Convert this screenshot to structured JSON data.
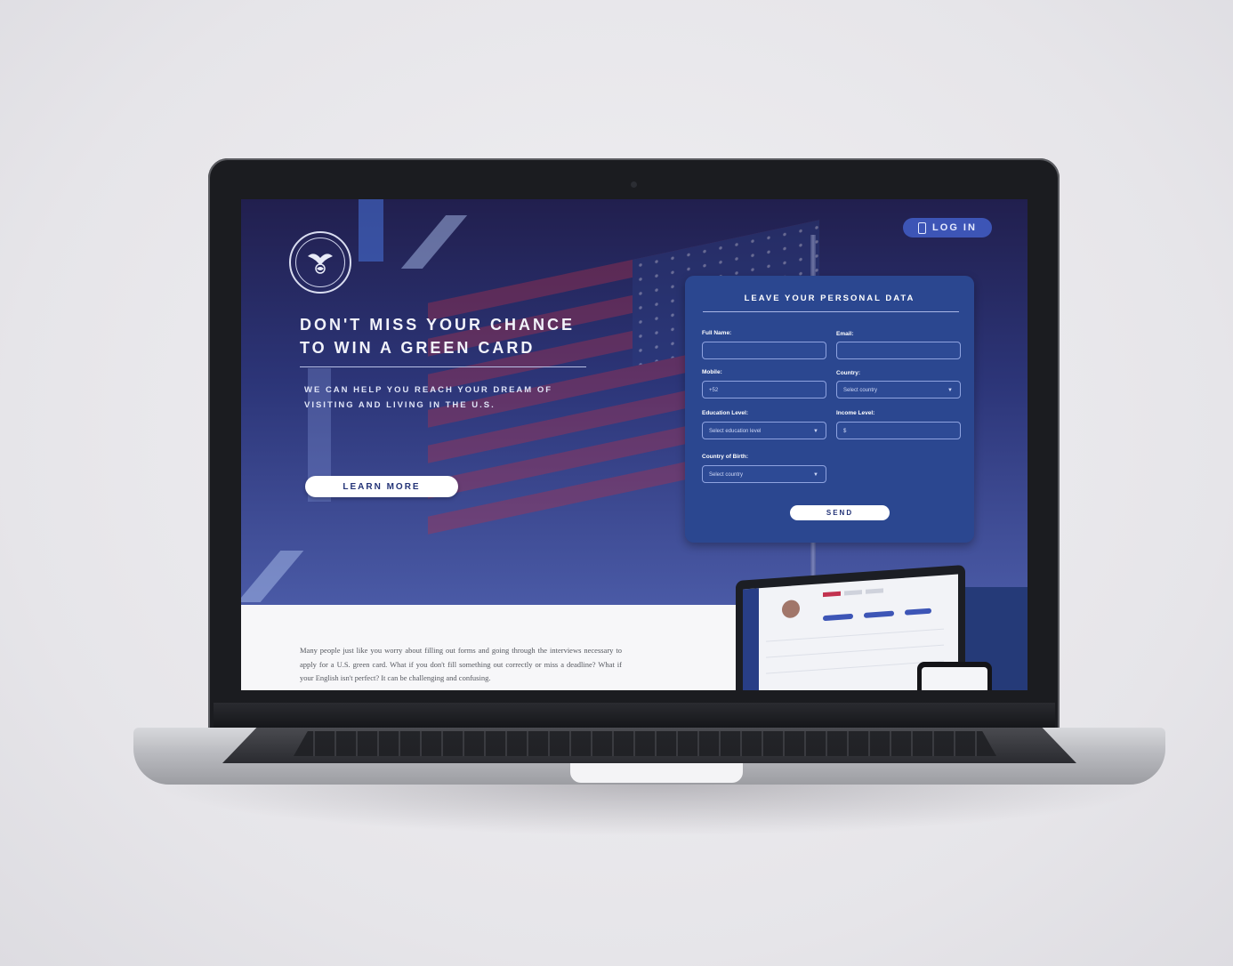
{
  "header": {
    "login_label": "LOG IN"
  },
  "hero": {
    "headline_line1": "DON'T MISS YOUR CHANCE",
    "headline_line2": "TO WIN A GREEN CARD",
    "subtitle_line1": "WE CAN HELP YOU REACH YOUR DREAM OF",
    "subtitle_line2": "VISITING AND LIVING IN THE U.S.",
    "learn_more_label": "LEARN MORE"
  },
  "form": {
    "title": "LEAVE YOUR PERSONAL DATA",
    "full_name_label": "Full Name:",
    "email_label": "Email:",
    "mobile_label": "Mobile:",
    "mobile_value": "+52",
    "country_label": "Country:",
    "country_placeholder": "Select country",
    "education_label": "Education Level:",
    "education_placeholder": "Select education level",
    "income_label": "Income Level:",
    "income_value": "$",
    "birth_country_label": "Country of Birth:",
    "birth_country_placeholder": "Select country",
    "send_label": "SEND"
  },
  "content": {
    "paragraph": "Many people just like you worry about filling out forms and going through the interviews necessary to apply for a U.S. green card. What if you don't fill something out correctly or miss a deadline? What if your English isn't perfect? It can be challenging and confusing."
  },
  "colors": {
    "hero_top": "#211f4e",
    "hero_bottom": "#4a5aa6",
    "form_panel": "#2b4790",
    "accent_button": "#3d55b6"
  },
  "icons": {
    "logo": "eagle-seal-icon",
    "login": "phone-icon",
    "dropdown": "caret-down-icon"
  }
}
